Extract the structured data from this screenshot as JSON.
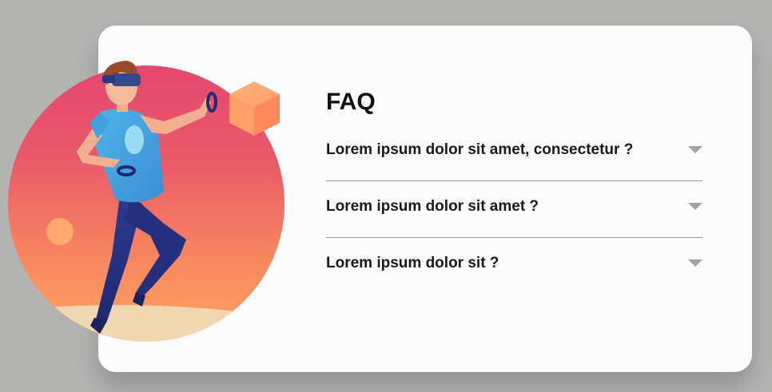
{
  "faq": {
    "title": "FAQ",
    "items": [
      {
        "question": "Lorem ipsum dolor sit amet, consectetur ?",
        "icon": "chevron-down-icon"
      },
      {
        "question": "Lorem ipsum dolor sit amet ?",
        "icon": "chevron-down-icon"
      },
      {
        "question": "Lorem ipsum dolor sit ?",
        "icon": "chevron-down-icon"
      }
    ]
  },
  "colors": {
    "page_background": "#b3b3b2",
    "card_background": "#fbfbfb",
    "circle_top": "#e5476f",
    "circle_bottom": "#ffa463",
    "chevron": "#a3a3a3",
    "divider": "#9b9b9b"
  },
  "illustration": {
    "icon": "vr-player-illustration"
  }
}
